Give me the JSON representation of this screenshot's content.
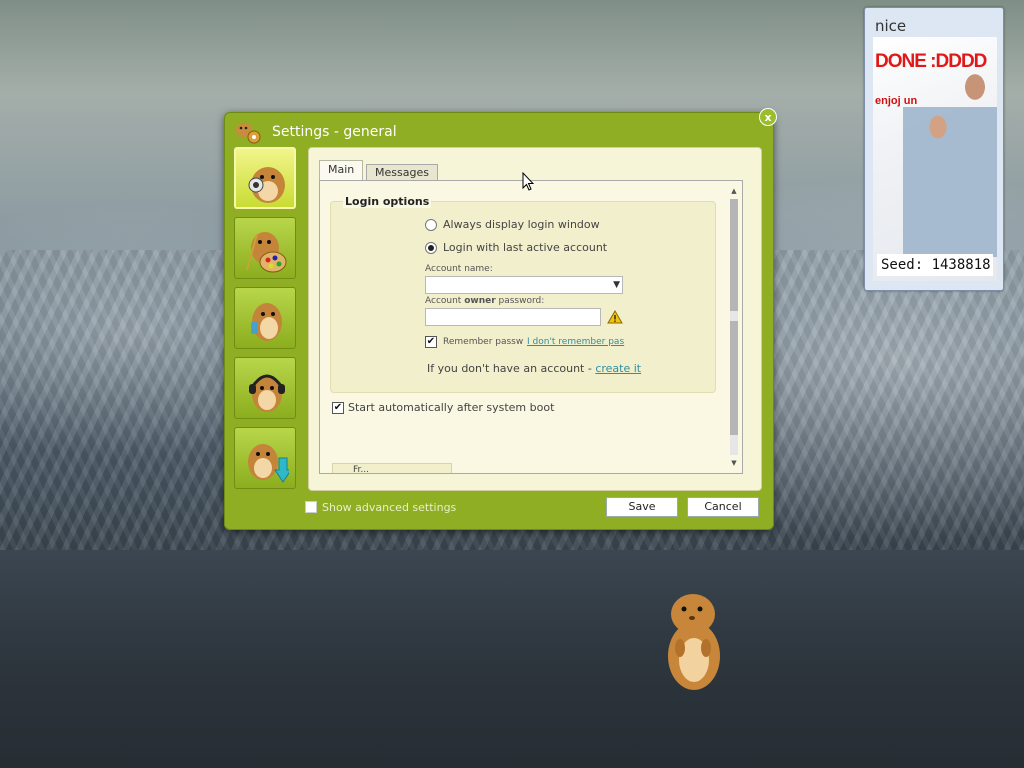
{
  "widget": {
    "title": "nice",
    "photo_heading": "DONE :DDDD",
    "photo_subtext": "enjoj un",
    "seed_label": "Seed: 1438818"
  },
  "dialog": {
    "title": "Settings - general",
    "close_label": "x",
    "sidebar": {
      "items": [
        {
          "name": "general",
          "active": true
        },
        {
          "name": "appearance",
          "active": false
        },
        {
          "name": "messaging",
          "active": false
        },
        {
          "name": "audio",
          "active": false
        },
        {
          "name": "updates",
          "active": false
        }
      ]
    },
    "tabs": [
      "Main",
      "Messages"
    ],
    "login_options": {
      "title": "Login options",
      "radio_always": "Always display login window",
      "radio_last": "Login with last active account",
      "account_name_label": "Account name:",
      "password_label_pre": "Account ",
      "password_label_bold": "owner",
      "password_label_post": " password:",
      "remember_label": "Remember passw",
      "forgot_link": "I don't remember pas",
      "no_account_text": "If you don't have an account - ",
      "create_link": "create it"
    },
    "autostart_label": "Start automatically after system boot",
    "cut_off_button": "Fr...",
    "advanced_label": "Show advanced settings",
    "save_label": "Save",
    "cancel_label": "Cancel"
  }
}
